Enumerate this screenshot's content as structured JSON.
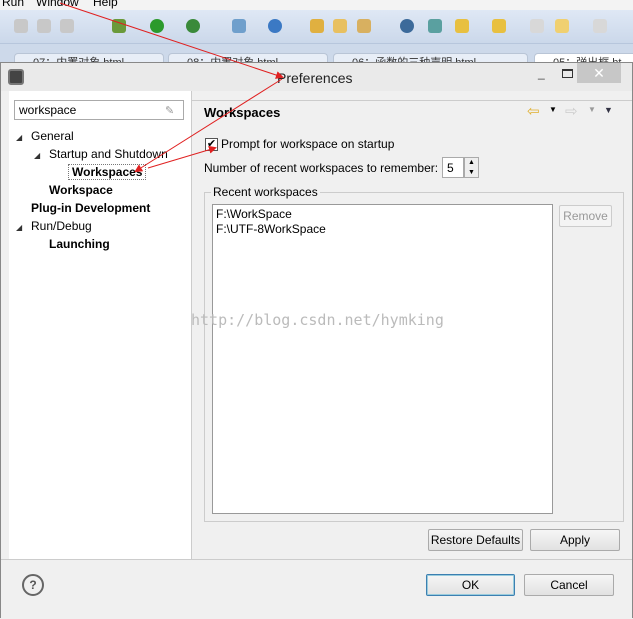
{
  "menubar": {
    "items": [
      "Run",
      "Window",
      "Help"
    ]
  },
  "editor_tabs": [
    "07：内置对象.html",
    "08：内置对象.html",
    "06：函数的三种声明.html",
    "05：弹出框.ht"
  ],
  "dialog": {
    "title": "Preferences",
    "filter": {
      "value": "workspace"
    },
    "tree": [
      {
        "label": "General",
        "level": 0,
        "expanded": true,
        "bold": false
      },
      {
        "label": "Startup and Shutdown",
        "level": 1,
        "expanded": true,
        "bold": false
      },
      {
        "label": "Workspaces",
        "level": 2,
        "bold": true,
        "selected": true
      },
      {
        "label": "Workspace",
        "level": 1,
        "bold": true
      },
      {
        "label": "Plug-in Development",
        "level": 0,
        "bold": true
      },
      {
        "label": "Run/Debug",
        "level": 0,
        "expanded": true,
        "bold": false
      },
      {
        "label": "Launching",
        "level": 1,
        "bold": true
      }
    ],
    "page": {
      "title": "Workspaces",
      "prompt_checkbox": {
        "label": "Prompt for workspace on startup",
        "checked": true
      },
      "recent_count": {
        "label": "Number of recent workspaces to remember:",
        "value": "5"
      },
      "recent_group": {
        "label": "Recent workspaces",
        "items": [
          "F:\\WorkSpace",
          "F:\\UTF-8WorkSpace"
        ],
        "remove_label": "Remove"
      },
      "restore_label": "Restore Defaults",
      "apply_label": "Apply"
    },
    "ok_label": "OK",
    "cancel_label": "Cancel",
    "help_icon": "?"
  },
  "watermark": "http://blog.csdn.net/hymking",
  "colors": {
    "annotation_arrow": "#e02020",
    "toolbar_bg": "#cbd8ea"
  }
}
